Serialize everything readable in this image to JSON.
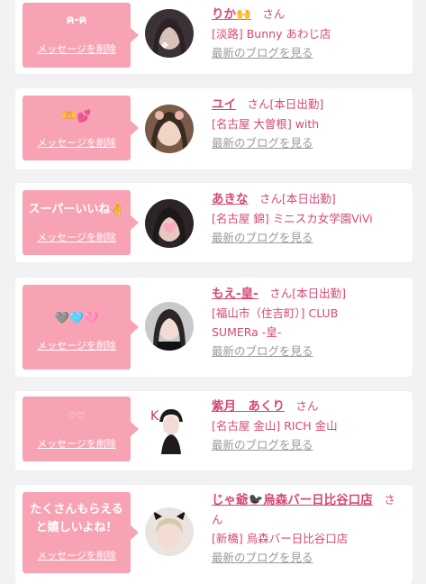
{
  "cards": [
    {
      "message": "ฅ-ฅ",
      "delete_label": "メッセージを削除",
      "name": "りか🙌",
      "honorific": "さん",
      "status": "",
      "shop": "[淡路] Bunny あわじ店",
      "blog_link": "最新のブログを見る"
    },
    {
      "message": "🫶💕",
      "delete_label": "メッセージを削除",
      "name": "ユイ",
      "honorific": "さん",
      "status": "[本日出勤]",
      "shop": "[名古屋 大曽根] with",
      "blog_link": "最新のブログを見る"
    },
    {
      "message": "スーパーいいね👌",
      "delete_label": "メッセージを削除",
      "name": "あきな",
      "honorific": "さん",
      "status": "[本日出勤]",
      "shop": "[名古屋 錦] ミニスカ女学園ViVi",
      "blog_link": "最新のブログを見る"
    },
    {
      "message": "🩶🩵🩷",
      "delete_label": "メッセージを削除",
      "name": "もえ-皇-",
      "honorific": "さん",
      "status": "[本日出勤]",
      "shop_line1": "[福山市（住吉町）] CLUB",
      "shop_line2": "SUMERa -皇-",
      "blog_link": "最新のブログを見る"
    },
    {
      "message": "♡♡",
      "delete_label": "メッセージを削除",
      "name": "紫月　あくり",
      "honorific": "さん",
      "status": "",
      "shop": "[名古屋 金山] RICH 金山",
      "blog_link": "最新のブログを見る"
    },
    {
      "message_line1": "たくさんもらえる",
      "message_line2": "と嬉しいよね！",
      "delete_label": "メッセージを削除",
      "name": "じゃ爺🐦‍⬛烏森バー日比谷口店",
      "honorific": "さ",
      "honorific_wrap": "ん",
      "status": "",
      "shop": "[新橋] 烏森バー日比谷口店",
      "blog_link": "最新のブログを見る"
    }
  ],
  "colors": {
    "accent": "#d64876",
    "bubble": "#f7a3b3",
    "muted": "#9a9a9a"
  }
}
